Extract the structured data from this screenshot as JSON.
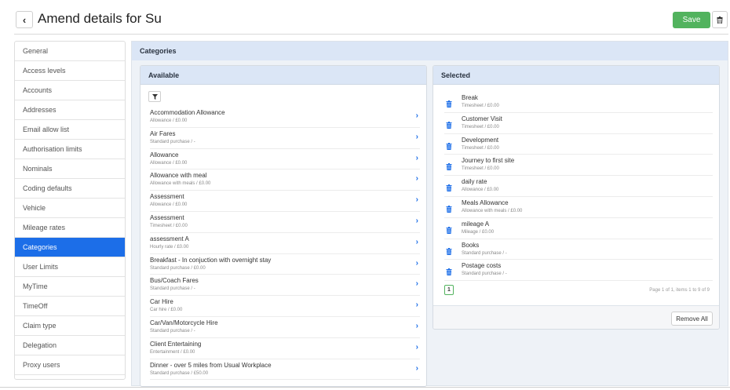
{
  "header": {
    "back_icon": "chevron-left-icon",
    "title": "Amend details for Su",
    "save_label": "Save",
    "delete_icon": "trash-icon"
  },
  "sidebar": {
    "items": [
      {
        "label": "General"
      },
      {
        "label": "Access levels"
      },
      {
        "label": "Accounts"
      },
      {
        "label": "Addresses"
      },
      {
        "label": "Email allow list"
      },
      {
        "label": "Authorisation limits"
      },
      {
        "label": "Nominals"
      },
      {
        "label": "Coding defaults"
      },
      {
        "label": "Vehicle"
      },
      {
        "label": "Mileage rates"
      },
      {
        "label": "Categories",
        "active": true
      },
      {
        "label": "User Limits"
      },
      {
        "label": "MyTime"
      },
      {
        "label": "TimeOff"
      },
      {
        "label": "Claim type"
      },
      {
        "label": "Delegation"
      },
      {
        "label": "Proxy users"
      }
    ]
  },
  "main": {
    "title": "Categories",
    "available": {
      "title": "Available",
      "filter_icon": "filter-icon",
      "items": [
        {
          "name": "Accommodation Allowance",
          "sub": "Allowance / £0.00"
        },
        {
          "name": "Air Fares",
          "sub": "Standard purchase / -"
        },
        {
          "name": "Allowance",
          "sub": "Allowance / £0.00"
        },
        {
          "name": "Allowance with meal",
          "sub": "Allowance with meals / £0.00"
        },
        {
          "name": "Assessment",
          "sub": "Allowance / £0.00"
        },
        {
          "name": "Assessment",
          "sub": "Timesheet / £0.00"
        },
        {
          "name": "assessment A",
          "sub": "Hourly rate / £0.00"
        },
        {
          "name": "Breakfast - In conjuction with overnight stay",
          "sub": "Standard purchase / £0.00"
        },
        {
          "name": "Bus/Coach Fares",
          "sub": "Standard purchase / -"
        },
        {
          "name": "Car Hire",
          "sub": "Car hire / £0.00"
        },
        {
          "name": "Car/Van/Motorcycle Hire",
          "sub": "Standard purchase / -"
        },
        {
          "name": "Client Entertaining",
          "sub": "Entertainment / £0.00"
        },
        {
          "name": "Dinner - over 5 miles from Usual Workplace",
          "sub": "Standard purchase / £50.00"
        }
      ]
    },
    "selected": {
      "title": "Selected",
      "items": [
        {
          "name": "Break",
          "sub": "Timesheet / £0.00"
        },
        {
          "name": "Customer Visit",
          "sub": "Timesheet / £0.00"
        },
        {
          "name": "Development",
          "sub": "Timesheet / £0.00"
        },
        {
          "name": "Journey to first site",
          "sub": "Timesheet / £0.00"
        },
        {
          "name": "daily rate",
          "sub": "Allowance / £0.00"
        },
        {
          "name": "Meals Allowance",
          "sub": "Allowance with meals / £0.00"
        },
        {
          "name": "mileage A",
          "sub": "Mileage / £0.00"
        },
        {
          "name": "Books",
          "sub": "Standard purchase / -"
        },
        {
          "name": "Postage costs",
          "sub": "Standard purchase / -"
        }
      ],
      "current_page": "1",
      "page_info": "Page 1 of 1, items 1 to 9 of 9",
      "remove_all_label": "Remove All"
    }
  },
  "colors": {
    "accent": "#1c6ee8",
    "save": "#52b35e",
    "panel_header": "#dbe6f6"
  }
}
